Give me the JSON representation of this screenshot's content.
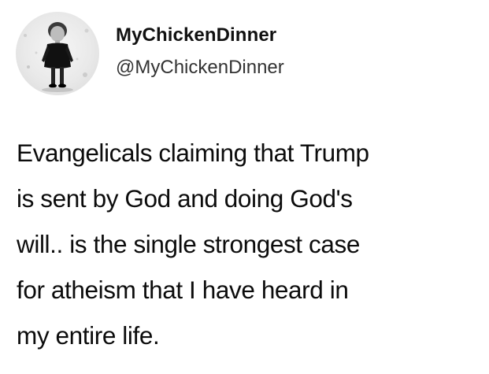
{
  "tweet": {
    "author": {
      "display_name": "MyChickenDinner",
      "handle": "@MyChickenDinner"
    },
    "text_lines": [
      "Evangelicals claiming that Trump",
      "is sent by God and doing God's",
      "will.. is the single strongest case",
      "for atheism that I have heard in",
      "my entire life."
    ]
  }
}
